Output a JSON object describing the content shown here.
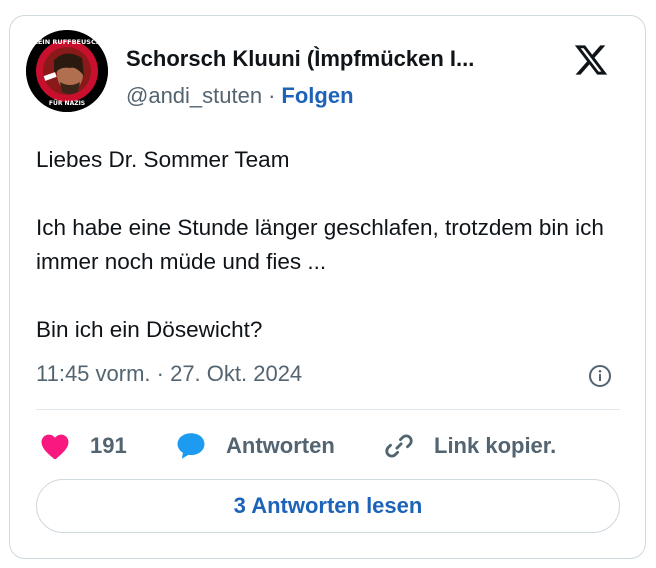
{
  "author": {
    "display_name": "Schorsch Kluuni (Ìmpfmücken I...",
    "handle": "@andi_stuten",
    "separator": "·",
    "follow_label": "Folgen",
    "avatar_badge_top": "KEIN RUFFBEUSCH",
    "avatar_badge_bottom": "FÜR NAZIS"
  },
  "tweet": {
    "lines": [
      "Liebes Dr. Sommer Team",
      "Ich habe eine Stunde länger geschlafen, trotzdem bin ich immer noch müde und fies ...",
      "Bin ich ein Dösewicht?"
    ],
    "timestamp": "11:45 vorm. · 27. Okt. 2024"
  },
  "actions": {
    "like_count": "191",
    "reply_label": "Antworten",
    "copy_label": "Link kopier."
  },
  "read_replies_label": "3 Antworten lesen",
  "colors": {
    "like_heart": "#f91880",
    "reply_bubble": "#1d9bf0",
    "link_blue": "#1d63b8",
    "secondary_text": "#536471",
    "border": "#cfd9de"
  },
  "icons": [
    "x-logo-icon",
    "info-icon",
    "heart-icon",
    "reply-bubble-icon",
    "link-icon"
  ]
}
